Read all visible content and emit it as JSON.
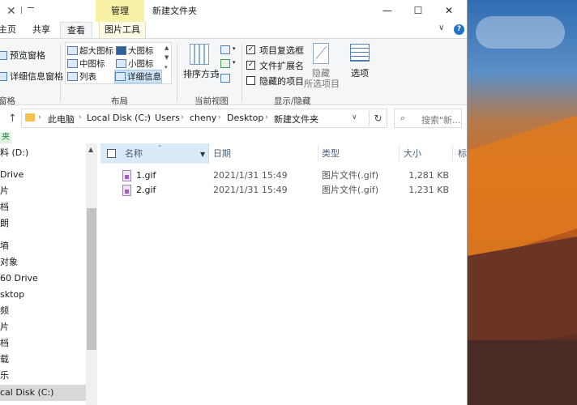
{
  "window": {
    "title": "新建文件夹",
    "context_tab": "管理",
    "min_glyph": "—",
    "max_glyph": "☐",
    "close_glyph": "✕",
    "qa_close_glyph": "✕",
    "qa_sep_glyph": "|"
  },
  "tabs": {
    "home": "主页",
    "share": "共享",
    "view": "查看",
    "picture_tools": "图片工具",
    "chevron": "∨",
    "help": "?"
  },
  "ribbon": {
    "panes": {
      "preview": "预览窗格",
      "details": "详细信息窗格",
      "group": "窗格"
    },
    "layout": {
      "extra_large": "超大图标",
      "large": "大图标",
      "medium": "中图标",
      "small": "小图标",
      "list": "列表",
      "details": "详细信息",
      "group": "布局",
      "scroll_up": "▲",
      "scroll_down": "▼",
      "scroll_more": "▾"
    },
    "current_view": {
      "sort": "排序方式",
      "group": "当前视图",
      "drop": "▾"
    },
    "show_hide": {
      "item_checkboxes": "项目复选框",
      "file_extensions": "文件扩展名",
      "hidden_items": "隐藏的项目",
      "item_checkboxes_checked": true,
      "file_extensions_checked": true,
      "hidden_items_checked": false,
      "hide_selected_1": "隐藏",
      "hide_selected_2": "所选项目",
      "group": "显示/隐藏"
    },
    "options": "选项"
  },
  "address": {
    "up_glyph": "↑",
    "segments": [
      "此电脑",
      "Local Disk (C:)",
      "Users",
      "cheny",
      "Desktop",
      "新建文件夹"
    ],
    "chevron": "›",
    "drop": "∨",
    "refresh": "↻",
    "search_placeholder": "搜索\"新...",
    "search_icon": "⌕"
  },
  "breadcrumb_strip": "夹",
  "nav": {
    "items": [
      {
        "label": "料 (D:)"
      },
      {
        "label": "Drive"
      },
      {
        "label": "片"
      },
      {
        "label": "档"
      },
      {
        "label": "朗"
      },
      {
        "label": "墒"
      },
      {
        "label": "对象"
      },
      {
        "label": "60 Drive"
      },
      {
        "label": "sktop"
      },
      {
        "label": "频"
      },
      {
        "label": "片"
      },
      {
        "label": "档"
      },
      {
        "label": "载"
      },
      {
        "label": "乐"
      },
      {
        "label": "cal Disk (C:)"
      }
    ],
    "selected_index": 14,
    "expand_glyph": "∧",
    "scroll_up": "▲"
  },
  "filelist": {
    "columns": {
      "name": "名称",
      "date": "日期",
      "type": "类型",
      "size": "大小",
      "tags": "标"
    },
    "sort_caret": "⌃",
    "filter_glyph": "▼",
    "rows": [
      {
        "name": "1.gif",
        "date": "2021/1/31 15:49",
        "type": "图片文件(.gif)",
        "size": "1,281 KB"
      },
      {
        "name": "2.gif",
        "date": "2021/1/31 15:49",
        "type": "图片文件(.gif)",
        "size": "1,231 KB"
      }
    ]
  }
}
